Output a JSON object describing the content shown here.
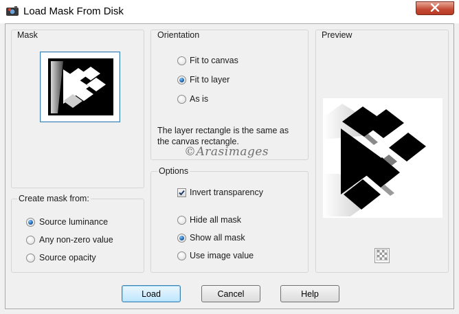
{
  "window": {
    "title": "Load Mask From Disk"
  },
  "mask": {
    "label": "Mask"
  },
  "create_mask_from": {
    "label": "Create mask from:",
    "options": [
      {
        "label": "Source luminance",
        "selected": true
      },
      {
        "label": "Any non-zero value",
        "selected": false
      },
      {
        "label": "Source opacity",
        "selected": false
      }
    ]
  },
  "orientation": {
    "label": "Orientation",
    "options": [
      {
        "label": "Fit to canvas",
        "selected": false
      },
      {
        "label": "Fit to layer",
        "selected": true
      },
      {
        "label": "As is",
        "selected": false
      }
    ],
    "info": "The layer rectangle is the same as the canvas rectangle."
  },
  "watermark": "©Arasimages",
  "options": {
    "label": "Options",
    "invert_transparency": {
      "label": "Invert transparency",
      "checked": true
    },
    "radios": [
      {
        "label": "Hide all mask",
        "selected": false
      },
      {
        "label": "Show all mask",
        "selected": true
      },
      {
        "label": "Use image value",
        "selected": false
      }
    ]
  },
  "preview": {
    "label": "Preview"
  },
  "buttons": {
    "load": "Load",
    "cancel": "Cancel",
    "help": "Help"
  },
  "icons": {
    "app": "paint-app-icon",
    "close": "close-icon",
    "transparency": "checkerboard-icon"
  }
}
